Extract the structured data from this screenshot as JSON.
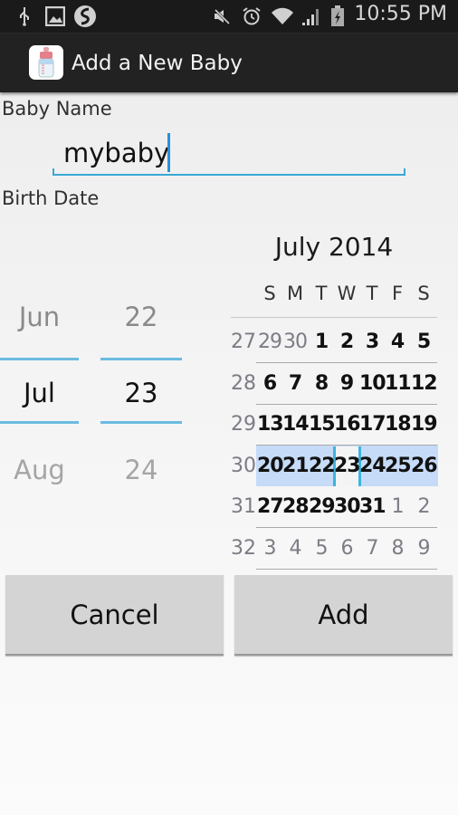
{
  "status_bar": {
    "left_icons": [
      "usb-icon",
      "gallery-icon",
      "swype-icon"
    ],
    "right_icons": [
      "mute-icon",
      "alarm-icon",
      "wifi-icon",
      "signal-icon",
      "battery-charging-icon"
    ],
    "time": "10:55 PM"
  },
  "action_bar": {
    "icon": "baby-bottle-icon",
    "title": "Add a New Baby"
  },
  "form": {
    "name_label": "Baby Name",
    "name_value": "mybaby",
    "birth_label": "Birth Date"
  },
  "date_picker": {
    "month_spinner": {
      "prev": "Jun",
      "selected": "Jul",
      "next": "Aug"
    },
    "day_spinner": {
      "prev": "22",
      "selected": "23",
      "next": "24"
    }
  },
  "calendar": {
    "title": "July 2014",
    "weekdays": [
      "S",
      "M",
      "T",
      "W",
      "T",
      "F",
      "S"
    ],
    "selected_day": "23",
    "weeks": [
      {
        "week": "27",
        "days": [
          {
            "d": "29",
            "in": false
          },
          {
            "d": "30",
            "in": false
          },
          {
            "d": "1",
            "in": true
          },
          {
            "d": "2",
            "in": true
          },
          {
            "d": "3",
            "in": true
          },
          {
            "d": "4",
            "in": true
          },
          {
            "d": "5",
            "in": true
          }
        ]
      },
      {
        "week": "28",
        "days": [
          {
            "d": "6",
            "in": true
          },
          {
            "d": "7",
            "in": true
          },
          {
            "d": "8",
            "in": true
          },
          {
            "d": "9",
            "in": true
          },
          {
            "d": "10",
            "in": true
          },
          {
            "d": "11",
            "in": true
          },
          {
            "d": "12",
            "in": true
          }
        ]
      },
      {
        "week": "29",
        "days": [
          {
            "d": "13",
            "in": true
          },
          {
            "d": "14",
            "in": true
          },
          {
            "d": "15",
            "in": true
          },
          {
            "d": "16",
            "in": true
          },
          {
            "d": "17",
            "in": true
          },
          {
            "d": "18",
            "in": true
          },
          {
            "d": "19",
            "in": true
          }
        ]
      },
      {
        "week": "30",
        "selected": true,
        "days": [
          {
            "d": "20",
            "in": true
          },
          {
            "d": "21",
            "in": true
          },
          {
            "d": "22",
            "in": true
          },
          {
            "d": "23",
            "in": true
          },
          {
            "d": "24",
            "in": true
          },
          {
            "d": "25",
            "in": true
          },
          {
            "d": "26",
            "in": true
          }
        ]
      },
      {
        "week": "31",
        "days": [
          {
            "d": "27",
            "in": true
          },
          {
            "d": "28",
            "in": true
          },
          {
            "d": "29",
            "in": true
          },
          {
            "d": "30",
            "in": true
          },
          {
            "d": "31",
            "in": true
          },
          {
            "d": "1",
            "in": false
          },
          {
            "d": "2",
            "in": false
          }
        ]
      },
      {
        "week": "32",
        "days": [
          {
            "d": "3",
            "in": false
          },
          {
            "d": "4",
            "in": false
          },
          {
            "d": "5",
            "in": false
          },
          {
            "d": "6",
            "in": false
          },
          {
            "d": "7",
            "in": false
          },
          {
            "d": "8",
            "in": false
          },
          {
            "d": "9",
            "in": false
          }
        ]
      }
    ]
  },
  "buttons": {
    "cancel": "Cancel",
    "add": "Add"
  },
  "colors": {
    "accent": "#3aa9d6",
    "selected_week_bg": "#c6dbf8",
    "button_bg": "#d4d4d4",
    "action_bar_bg": "#222222"
  }
}
